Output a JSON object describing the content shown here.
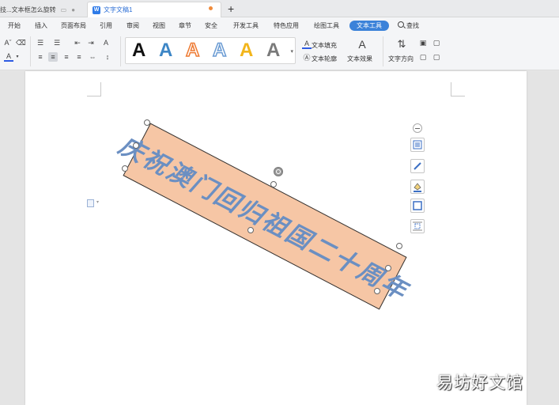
{
  "tabs": [
    {
      "label": "技...文本框怎么旋转"
    },
    {
      "label": "文字文稿1",
      "icon": "W"
    }
  ],
  "new_tab": "+",
  "menu": {
    "items": [
      "开始",
      "插入",
      "页面布局",
      "引用",
      "审阅",
      "视图",
      "章节",
      "安全",
      "开发工具",
      "特色应用",
      "绘图工具"
    ],
    "active": "文本工具",
    "search": "查找"
  },
  "ribbon": {
    "text_fill": "文本填充",
    "text_outline": "文本轮廓",
    "text_effect": "文本效果",
    "text_direction": "文字方向",
    "art_styles": [
      {
        "glyph": "A",
        "color": "#111111"
      },
      {
        "glyph": "A",
        "color": "#3d86c6"
      },
      {
        "glyph": "A",
        "color": "#ee7a32"
      },
      {
        "glyph": "A",
        "color": "#cfe0f2"
      },
      {
        "glyph": "A",
        "color": "#f2b51b"
      },
      {
        "glyph": "A",
        "color": "#7a7a7a"
      }
    ]
  },
  "textbox": {
    "text": "庆祝澳门回归祖国二十周年",
    "fill": "#f6c6a5",
    "text_color": "#6b8fc2"
  },
  "watermark": "易坊好文馆"
}
